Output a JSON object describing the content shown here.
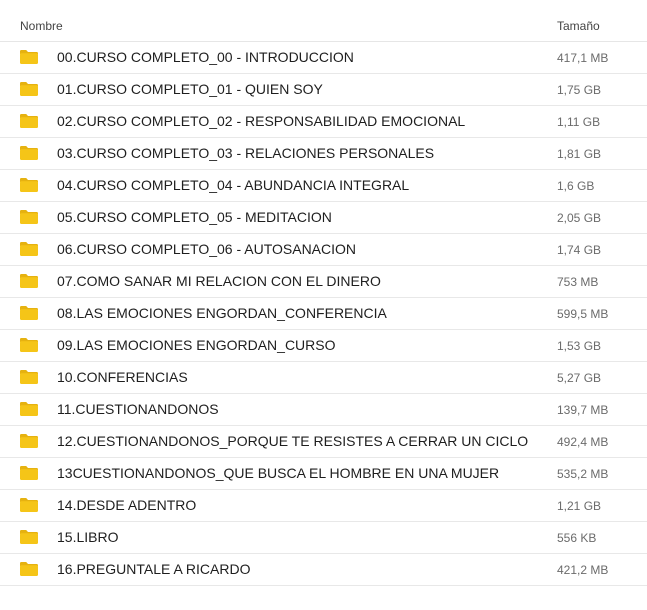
{
  "header": {
    "name_label": "Nombre",
    "size_label": "Tamaño"
  },
  "colors": {
    "folder_fill": "#f5c518",
    "folder_shade": "#e6b210",
    "divider": "#e8e8e8"
  },
  "files": [
    {
      "icon": "folder-icon",
      "name": "00.CURSO COMPLETO_00 - INTRODUCCION",
      "size": "417,1 MB"
    },
    {
      "icon": "folder-icon",
      "name": "01.CURSO COMPLETO_01 - QUIEN SOY",
      "size": "1,75 GB"
    },
    {
      "icon": "folder-icon",
      "name": "02.CURSO COMPLETO_02 - RESPONSABILIDAD EMOCIONAL",
      "size": "1,11 GB"
    },
    {
      "icon": "folder-icon",
      "name": "03.CURSO COMPLETO_03 - RELACIONES PERSONALES",
      "size": "1,81 GB"
    },
    {
      "icon": "folder-icon",
      "name": "04.CURSO COMPLETO_04 - ABUNDANCIA INTEGRAL",
      "size": "1,6 GB"
    },
    {
      "icon": "folder-icon",
      "name": "05.CURSO COMPLETO_05 - MEDITACION",
      "size": "2,05 GB"
    },
    {
      "icon": "folder-icon",
      "name": "06.CURSO COMPLETO_06 - AUTOSANACION",
      "size": "1,74 GB"
    },
    {
      "icon": "folder-icon",
      "name": "07.COMO SANAR MI RELACION CON EL DINERO",
      "size": "753 MB"
    },
    {
      "icon": "folder-icon",
      "name": "08.LAS EMOCIONES ENGORDAN_CONFERENCIA",
      "size": "599,5 MB"
    },
    {
      "icon": "folder-icon",
      "name": "09.LAS EMOCIONES ENGORDAN_CURSO",
      "size": "1,53 GB"
    },
    {
      "icon": "folder-icon",
      "name": "10.CONFERENCIAS",
      "size": "5,27 GB"
    },
    {
      "icon": "folder-icon",
      "name": "11.CUESTIONANDONOS",
      "size": "139,7 MB"
    },
    {
      "icon": "folder-icon",
      "name": "12.CUESTIONANDONOS_PORQUE TE RESISTES A CERRAR UN CICLO",
      "size": "492,4 MB"
    },
    {
      "icon": "folder-icon",
      "name": "13CUESTIONANDONOS_QUE BUSCA EL HOMBRE EN UNA MUJER",
      "size": "535,2 MB"
    },
    {
      "icon": "folder-icon",
      "name": "14.DESDE ADENTRO",
      "size": "1,21 GB"
    },
    {
      "icon": "folder-icon",
      "name": "15.LIBRO",
      "size": "556 KB"
    },
    {
      "icon": "folder-icon",
      "name": "16.PREGUNTALE A RICARDO",
      "size": "421,2 MB"
    }
  ]
}
